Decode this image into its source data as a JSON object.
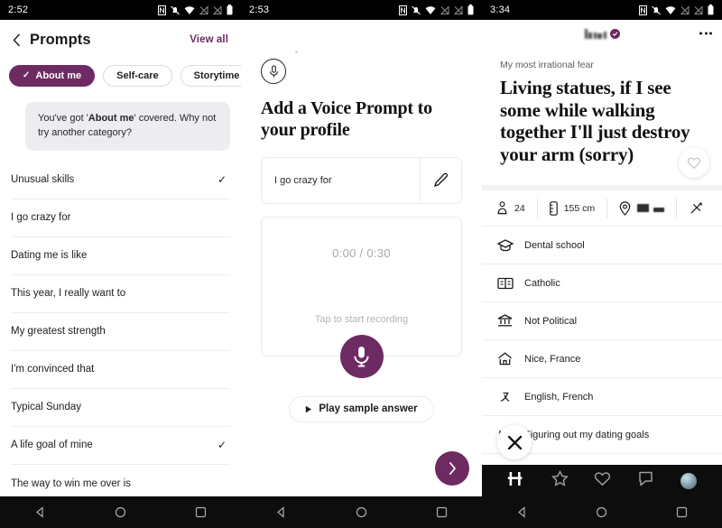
{
  "screens": [
    {
      "statusbar": {
        "time": "2:52"
      },
      "header": {
        "title": "Prompts",
        "view_all": "View all",
        "back_icon": "chevron-left-icon"
      },
      "chips": [
        {
          "label": "About me",
          "active": true,
          "check": "✓"
        },
        {
          "label": "Self-care",
          "active": false
        },
        {
          "label": "Storytime",
          "active": false
        }
      ],
      "banner": {
        "pre": "You've got '",
        "bold": "About me",
        "post": "' covered. Why not try another category?"
      },
      "prompts": [
        {
          "label": "Unusual skills",
          "checked": true
        },
        {
          "label": "I go crazy for",
          "checked": false
        },
        {
          "label": "Dating me is like",
          "checked": false
        },
        {
          "label": "This year, I really want to",
          "checked": false
        },
        {
          "label": "My greatest strength",
          "checked": false
        },
        {
          "label": "I'm convinced that",
          "checked": false
        },
        {
          "label": "Typical Sunday",
          "checked": false
        },
        {
          "label": "A life goal of mine",
          "checked": true
        },
        {
          "label": "The way to win me over is",
          "checked": false
        }
      ]
    },
    {
      "statusbar": {
        "time": "2:53"
      },
      "title": "Add a Voice Prompt to your profile",
      "mic_icon": "microphone-icon",
      "prompt_field": {
        "value": "I go crazy for",
        "edit_icon": "pencil-edit-icon"
      },
      "recorder": {
        "time": "0:00 / 0:30",
        "hint": "Tap to start recording",
        "record_icon": "microphone-icon"
      },
      "sample_button": {
        "label": "Play sample answer",
        "icon": "play-triangle-icon"
      },
      "next_button": {
        "icon": "chevron-right-icon"
      }
    },
    {
      "statusbar": {
        "time": "3:34"
      },
      "topbar": {
        "name_redacted": true,
        "verified_icon": "verified-check-icon",
        "menu_icon": "more-horizontal-icon"
      },
      "card": {
        "prompt": "My most irrational fear",
        "answer": "Living statues, if I see some while walking together I'll just destroy your arm (sorry)",
        "like_icon": "heart-outline-icon"
      },
      "pills": [
        {
          "icon": "person-icon",
          "value": "24"
        },
        {
          "icon": "ruler-icon",
          "value": "155 cm"
        },
        {
          "icon": "location-pin-icon",
          "value": "",
          "redacted": true
        },
        {
          "icon": "zodiac-icon",
          "value": ""
        }
      ],
      "info_rows": [
        {
          "icon": "graduation-cap-icon",
          "label": "Dental school"
        },
        {
          "icon": "book-icon",
          "label": "Catholic"
        },
        {
          "icon": "government-building-icon",
          "label": "Not Political"
        },
        {
          "icon": "home-icon",
          "label": "Nice, France"
        },
        {
          "icon": "speech-language-icon",
          "label": "English, French"
        },
        {
          "icon": "search-goal-icon",
          "label": "Figuring out my dating goals"
        }
      ],
      "reject_button": {
        "icon": "close-x-icon"
      },
      "tabbar": [
        {
          "icon": "hinge-logo-icon",
          "active": true
        },
        {
          "icon": "star-icon",
          "active": false
        },
        {
          "icon": "heart-icon",
          "active": false
        },
        {
          "icon": "chat-bubble-icon",
          "active": false
        },
        {
          "icon": "profile-avatar-icon",
          "active": false
        }
      ]
    }
  ],
  "android_nav": {
    "back": "back-triangle-icon",
    "home": "home-circle-icon",
    "recents": "recents-square-icon"
  },
  "colors": {
    "accent": "#6d2a63",
    "statusbar_bg": "#000000",
    "tabbar_bg": "#0d0d0d",
    "banner_bg": "#ededf1"
  }
}
